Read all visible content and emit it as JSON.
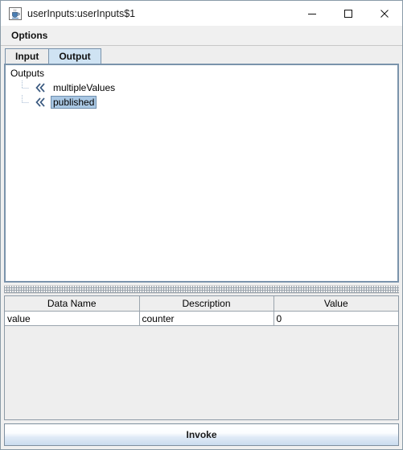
{
  "window": {
    "title": "userInputs:userInputs$1",
    "icon": "java-coffee-cup-icon",
    "controls": {
      "minimize": "minimize-icon",
      "maximize": "maximize-icon",
      "close": "close-icon"
    }
  },
  "menubar": {
    "items": [
      {
        "label": "Options"
      }
    ]
  },
  "tabs": [
    {
      "label": "Input",
      "active": false
    },
    {
      "label": "Output",
      "active": true
    }
  ],
  "tree": {
    "root": "Outputs",
    "nodes": [
      {
        "label": "multipleValues",
        "icon": "double-chevron-left-icon",
        "selected": false
      },
      {
        "label": "published",
        "icon": "double-chevron-left-icon",
        "selected": true
      }
    ]
  },
  "table": {
    "columns": [
      "Data Name",
      "Description",
      "Value"
    ],
    "rows": [
      [
        "value",
        "counter",
        "0"
      ]
    ]
  },
  "footer": {
    "invoke_label": "Invoke"
  },
  "colors": {
    "tab_active_bg": "#cfe3f3",
    "tab_inactive_bg": "#ececec",
    "panel_border": "#7a93ab",
    "selection_bg": "#aac8e4",
    "panel_bg": "#eeeeee",
    "node_icon": "#3b5a80"
  }
}
